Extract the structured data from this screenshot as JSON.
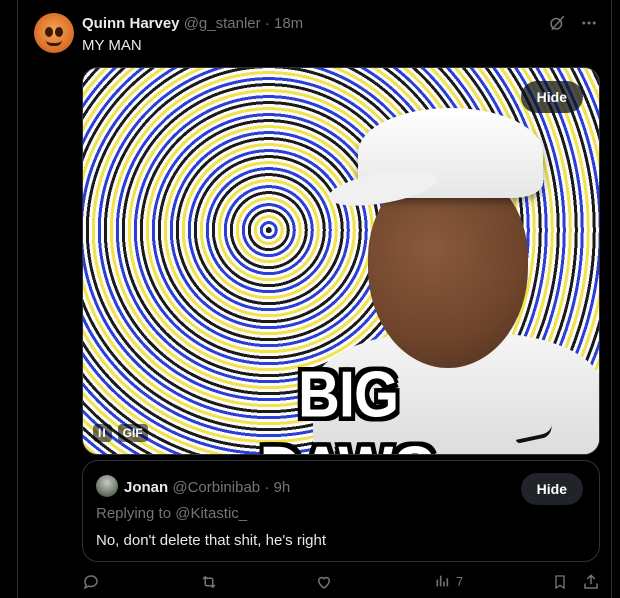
{
  "post": {
    "author_name": "Quinn Harvey",
    "author_handle": "@g_stanler",
    "separator": "·",
    "time": "18m",
    "text": "MY MAN"
  },
  "media": {
    "caption": "BIG DAWG",
    "hide_label": "Hide",
    "pause_label": "II",
    "gif_label": "GIF"
  },
  "quote": {
    "author_name": "Jonan",
    "author_handle": "@Corbinibab",
    "separator": "·",
    "time": "9h",
    "replying_prefix": "Replying to ",
    "replying_to": "@Kitastic_",
    "text": "No, don't delete that shit, he's right",
    "hide_label": "Hide"
  },
  "actions": {
    "views_count": "7"
  },
  "icons": [
    "grok-icon",
    "more-icon",
    "reply-icon",
    "retweet-icon",
    "like-icon",
    "views-icon",
    "bookmark-icon",
    "share-icon"
  ],
  "colors": {
    "background": "#000000",
    "text": "#e7e9ea",
    "muted": "#71767b",
    "border": "#2f3336"
  }
}
